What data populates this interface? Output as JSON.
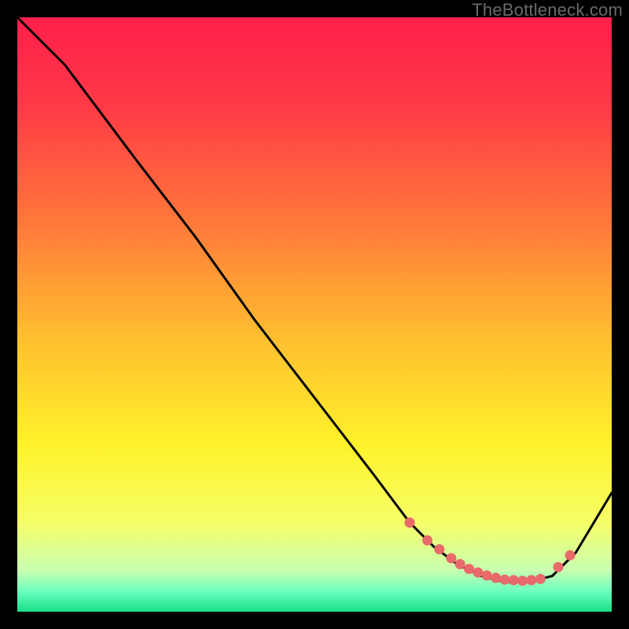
{
  "watermark": "TheBottleneck.com",
  "chart_data": {
    "type": "line",
    "title": "",
    "xlabel": "",
    "ylabel": "",
    "xlim": [
      0,
      100
    ],
    "ylim": [
      0,
      100
    ],
    "grid": false,
    "series": [
      {
        "name": "curve",
        "x": [
          0,
          8,
          20,
          30,
          40,
          50,
          60,
          66,
          70,
          74,
          78,
          82,
          86,
          90,
          94,
          100
        ],
        "y": [
          100,
          92,
          76,
          63,
          49,
          36,
          23,
          15,
          11,
          8,
          6,
          5,
          5,
          6,
          10,
          20
        ]
      }
    ],
    "markers": {
      "name": "highlight-dots",
      "color": "#e86a6a",
      "x": [
        66,
        69,
        71,
        73,
        74.5,
        76,
        77.5,
        79,
        80.5,
        82,
        83.5,
        85,
        86.5,
        88,
        91,
        93
      ],
      "y": [
        15,
        12,
        10.5,
        9,
        8,
        7.2,
        6.6,
        6.1,
        5.7,
        5.4,
        5.3,
        5.2,
        5.3,
        5.5,
        7.5,
        9.5
      ]
    },
    "gradient_stops": [
      {
        "offset": 0.0,
        "color": "#ff1f4b"
      },
      {
        "offset": 0.15,
        "color": "#ff3a46"
      },
      {
        "offset": 0.35,
        "color": "#ff7a3a"
      },
      {
        "offset": 0.55,
        "color": "#ffc22f"
      },
      {
        "offset": 0.72,
        "color": "#fff22a"
      },
      {
        "offset": 0.85,
        "color": "#f6ff68"
      },
      {
        "offset": 0.93,
        "color": "#c9ffb0"
      },
      {
        "offset": 0.965,
        "color": "#6effc0"
      },
      {
        "offset": 1.0,
        "color": "#18e08a"
      }
    ]
  }
}
